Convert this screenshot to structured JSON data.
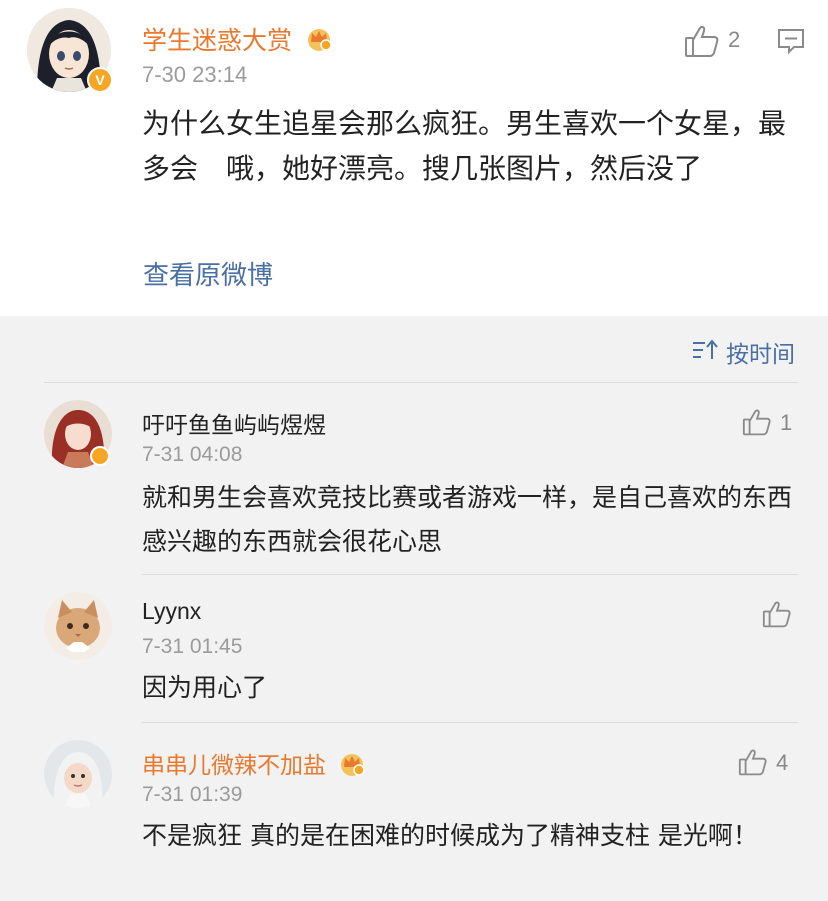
{
  "post": {
    "author": "学生迷惑大赏",
    "verified_mark": "V",
    "timestamp": "7-30 23:14",
    "like_count": "2",
    "text": "为什么女生追星会那么疯狂。男生喜欢一个女星，最多会　哦，她好漂亮。搜几张图片，然后没了",
    "view_original": "查看原微博"
  },
  "comments_header": {
    "sort_label": "按时间",
    "sort_icon": "sort-icon"
  },
  "comments": [
    {
      "author": "吁吁鱼鱼屿屿煜煜",
      "timestamp": "7-31 04:08",
      "likes": "1",
      "text": "就和男生会喜欢竞技比赛或者游戏一样，是自己喜欢的东西感兴趣的东西就会很花心思"
    },
    {
      "author": "Lyynx",
      "timestamp": "7-31 01:45",
      "likes": "",
      "text": "因为用心了"
    },
    {
      "author": "串串儿微辣不加盐",
      "timestamp": "7-31 01:39",
      "likes": "4",
      "text": "不是疯狂 真的是在困难的时候成为了精神支柱 是光啊！"
    }
  ],
  "colors": {
    "vip_name": "#e8792e",
    "link": "#4a6fa5",
    "timestamp": "#9b9b9b",
    "comments_bg": "#f2f2f2",
    "badge": "#f5a623"
  }
}
